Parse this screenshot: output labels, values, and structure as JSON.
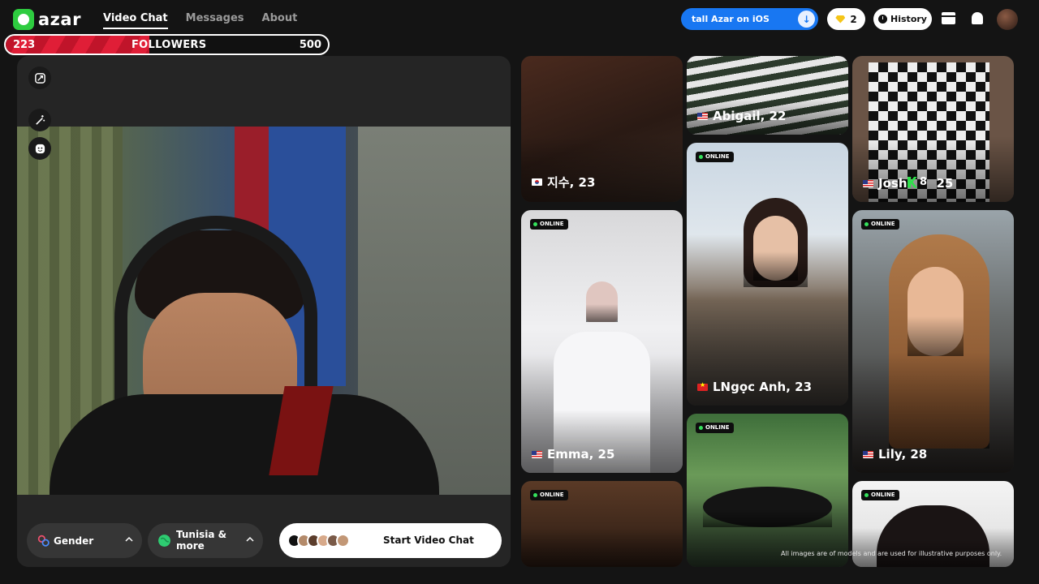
{
  "brand": {
    "name": "azar"
  },
  "nav": {
    "items": [
      "Video Chat",
      "Messages",
      "About"
    ],
    "active": "Video Chat"
  },
  "header": {
    "ios_label": "tall Azar on iOS",
    "gems_count": "2",
    "history_label": "History"
  },
  "followers": {
    "current": "223",
    "label": "FOLLOWERS",
    "goal": "500",
    "progress_fraction": 0.446
  },
  "filters": {
    "gender_label": "Gender",
    "region_label": "Tunisia & more"
  },
  "start_button": {
    "label": "Start Video Chat"
  },
  "cards": [
    {
      "name": "지수, 23",
      "online": false,
      "flag": "kr"
    },
    {
      "name": "Emma, 25",
      "online": true,
      "online_label": "ONLINE",
      "flag": "us"
    },
    {
      "name": "",
      "online": true,
      "online_label": "ONLINE"
    },
    {
      "name": "Abigail, 22",
      "online": false,
      "flag": "us"
    },
    {
      "name": "LNgọc Anh, 23",
      "online": true,
      "online_label": "ONLINE",
      "flag": "vn"
    },
    {
      "name": "",
      "online": true,
      "online_label": "ONLINE"
    },
    {
      "name": "Josh",
      "name_suffix": "25",
      "online": false,
      "flag": "us"
    },
    {
      "name": "Lily, 28",
      "online": true,
      "online_label": "ONLINE",
      "flag": "us"
    },
    {
      "name": "",
      "online": true,
      "online_label": "ONLINE"
    }
  ],
  "kick_overlay": {
    "count": "8"
  },
  "disclaimer": "All images are of models and are used for illustrative purposes only.",
  "colors": {
    "accent_blue": "#1877f2",
    "online_green": "#35e15c",
    "followers_red": "#e01e37",
    "background": "#141414"
  }
}
